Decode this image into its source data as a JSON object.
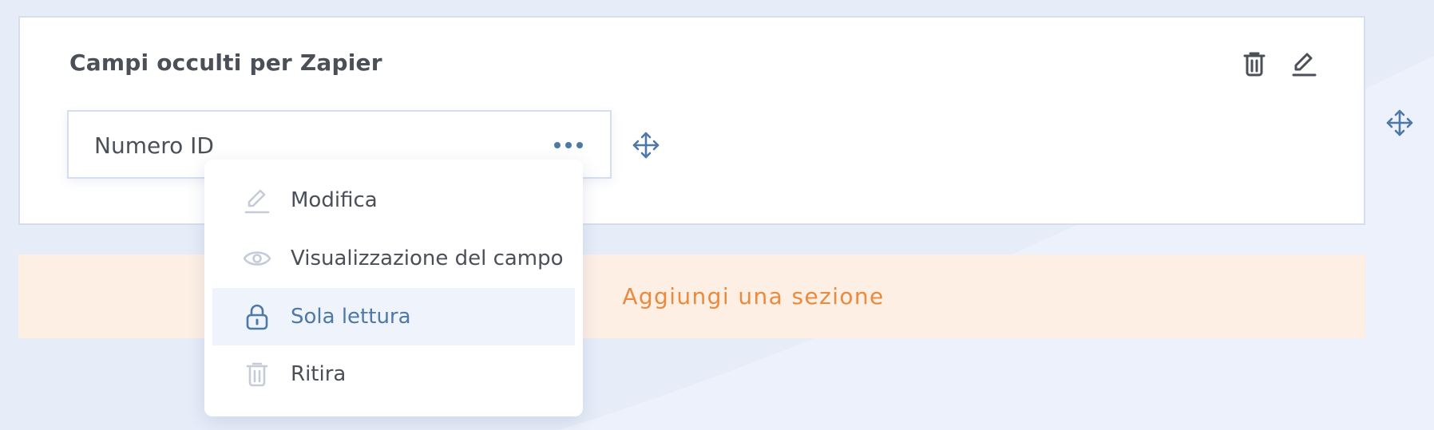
{
  "section": {
    "title": "Campi occulti per Zapier",
    "delete_icon": "trash-icon",
    "edit_icon": "pencil-icon",
    "drag_icon": "move-icon"
  },
  "field": {
    "label": "Numero ID",
    "more_icon": "more-horizontal-icon",
    "drag_icon": "move-icon"
  },
  "add_section": {
    "label": "Aggiungi una sezione"
  },
  "context_menu": {
    "items": [
      {
        "label": "Modifica",
        "icon": "pencil-icon",
        "active": false
      },
      {
        "label": "Visualizzazione del campo",
        "icon": "eye-icon",
        "active": false
      },
      {
        "label": "Sola lettura",
        "icon": "lock-icon",
        "active": true
      },
      {
        "label": "Ritira",
        "icon": "trash-icon",
        "active": false
      }
    ]
  },
  "colors": {
    "background": "#e6ecf8",
    "card": "#ffffff",
    "border": "#d6deee",
    "text": "#4b4f57",
    "accent_blue": "#4e78a6",
    "accent_orange": "#e98a3f",
    "add_section_bg": "#fdefe4",
    "menu_active_bg": "#eef3fc",
    "muted_icon": "#c5ccd8"
  }
}
